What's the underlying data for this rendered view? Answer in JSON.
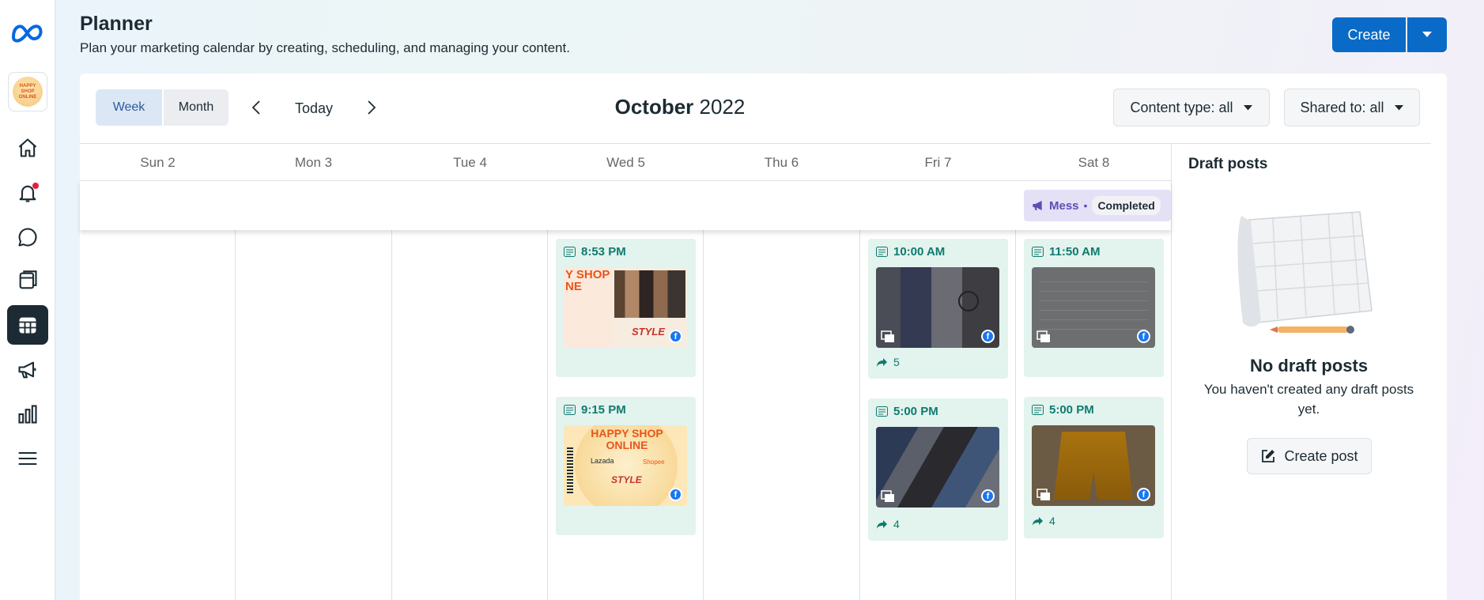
{
  "header": {
    "title": "Planner",
    "subtitle": "Plan your marketing calendar by creating, scheduling, and managing your content.",
    "create_label": "Create"
  },
  "sidebar": {
    "avatar_text": "HAPPY SHOP ONLINE",
    "items": [
      {
        "name": "home",
        "icon": "home-icon"
      },
      {
        "name": "notifications",
        "icon": "bell-icon"
      },
      {
        "name": "inbox",
        "icon": "chat-bubble-icon"
      },
      {
        "name": "content",
        "icon": "pages-icon"
      },
      {
        "name": "planner",
        "icon": "calendar-icon",
        "active": true
      },
      {
        "name": "ads",
        "icon": "megaphone-icon"
      },
      {
        "name": "insights",
        "icon": "bar-chart-icon"
      },
      {
        "name": "menu",
        "icon": "hamburger-icon"
      }
    ]
  },
  "toolbar": {
    "week_label": "Week",
    "month_label": "Month",
    "today_label": "Today",
    "month_name": "October",
    "year": "2022",
    "content_type_label": "Content type: all",
    "shared_to_label": "Shared to: all"
  },
  "calendar": {
    "days": [
      "Sun 2",
      "Mon 3",
      "Tue 4",
      "Wed 5",
      "Thu 6",
      "Fri 7",
      "Sat 8"
    ],
    "allday_event": {
      "name": "Mess",
      "separator": "•",
      "status": "Completed"
    },
    "posts": [
      {
        "day": "Wed 5",
        "time": "8:53 PM",
        "thumb_text": "Y SHOP NE",
        "thumb_sub": "STYLE",
        "share_count": null
      },
      {
        "day": "Wed 5",
        "time": "9:15 PM",
        "thumb_text": "HAPPY SHOP ONLINE",
        "thumb_sub": "STYLE",
        "thumb_lazada": "Lazada",
        "thumb_shopee": "Shopee",
        "share_count": null
      },
      {
        "day": "Fri 7",
        "time": "10:00 AM",
        "share_count": "5"
      },
      {
        "day": "Fri 7",
        "time": "5:00 PM",
        "share_count": "4"
      },
      {
        "day": "Sat 8",
        "time": "11:50 AM",
        "share_count": null
      },
      {
        "day": "Sat 8",
        "time": "5:00 PM",
        "share_count": "4"
      }
    ]
  },
  "drafts": {
    "title": "Draft posts",
    "empty_title": "No draft posts",
    "empty_text": "You haven't created any draft posts yet.",
    "create_label": "Create post"
  },
  "colors": {
    "primary": "#0a6ac7",
    "post_bg": "#e3f3ee",
    "post_text": "#0e7b6e",
    "event_bg": "#e4e1f7",
    "event_text": "#5b4fb5",
    "facebook": "#1877f2"
  }
}
